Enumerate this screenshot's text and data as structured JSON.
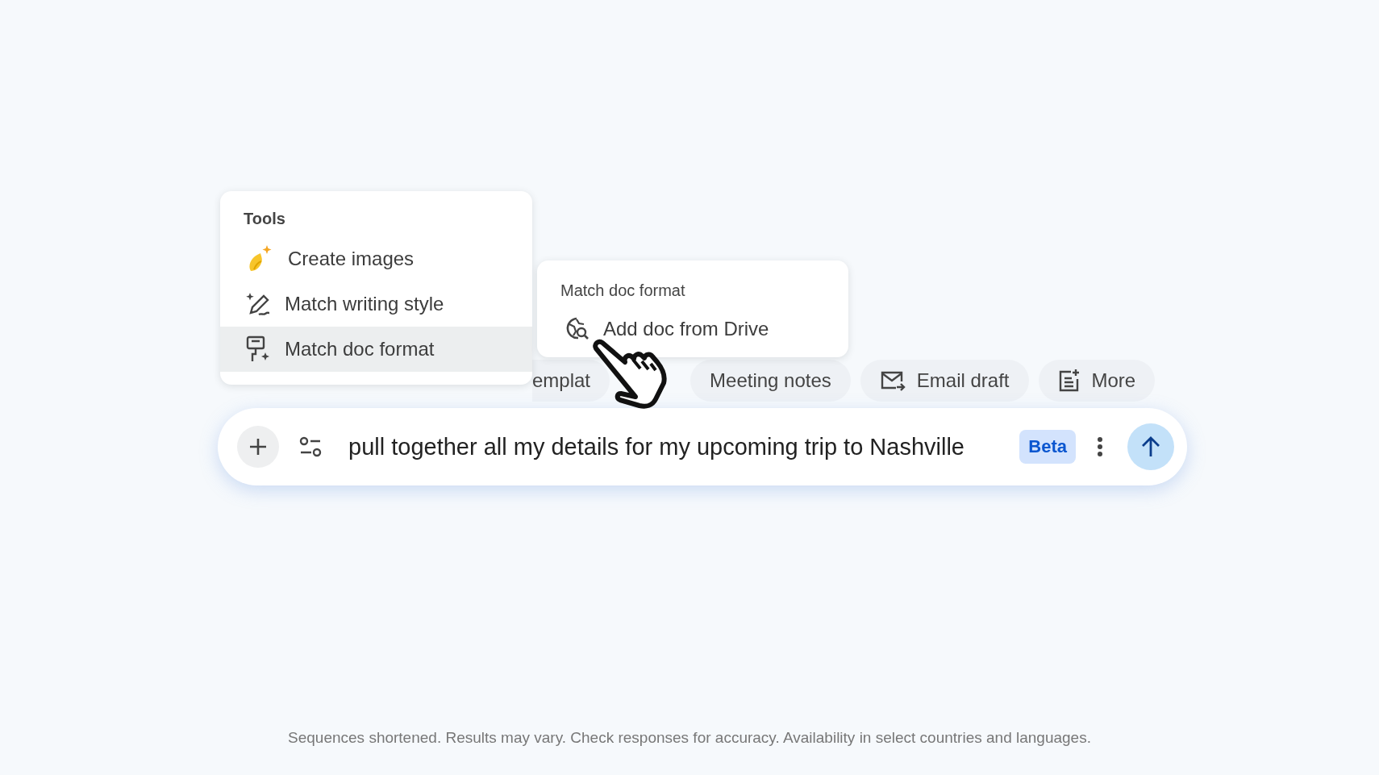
{
  "tools_menu": {
    "title": "Tools",
    "items": [
      {
        "label": "Create images",
        "selected": false
      },
      {
        "label": "Match writing style",
        "selected": false
      },
      {
        "label": "Match doc format",
        "selected": true
      }
    ]
  },
  "submenu": {
    "title": "Match doc format",
    "items": [
      {
        "label": "Add doc from Drive"
      }
    ]
  },
  "suggestion_chips": [
    {
      "label": "emplat"
    },
    {
      "label": "Meeting notes"
    },
    {
      "label": "Email draft"
    },
    {
      "label": "More"
    }
  ],
  "prompt": {
    "value": "pull together all my details for my upcoming trip to Nashville",
    "badge": "Beta"
  },
  "footer": "Sequences shortened. Results may vary. Check responses for accuracy. Availability in select countries and languages."
}
